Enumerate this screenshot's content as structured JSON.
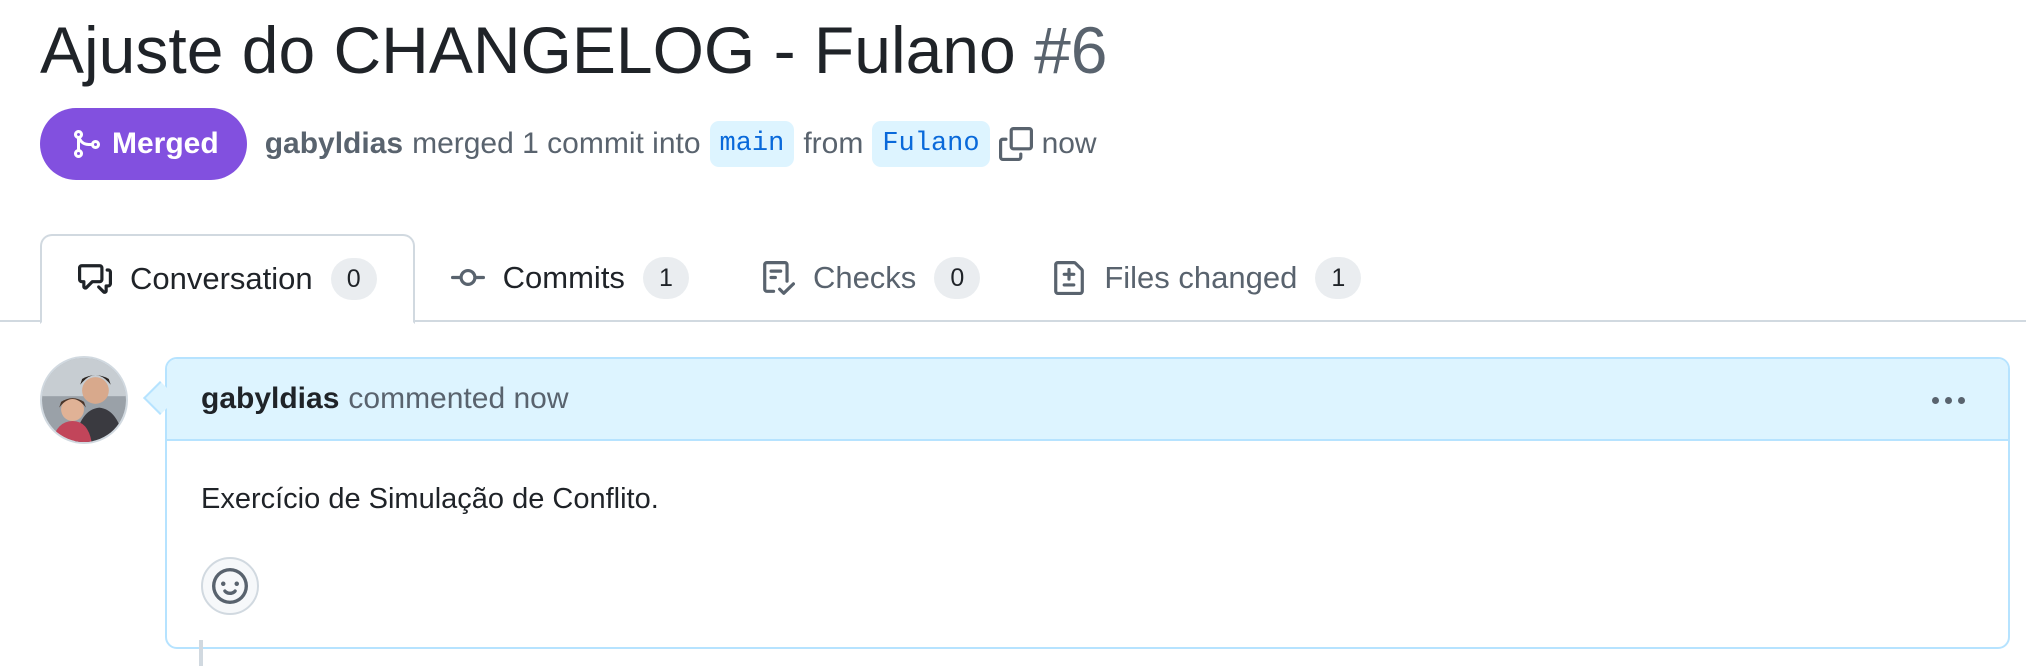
{
  "header": {
    "title": "Ajuste do CHANGELOG - Fulano",
    "number": "#6"
  },
  "meta": {
    "state_label": "Merged",
    "author": "gabyldias",
    "action": "merged 1 commit into",
    "base_branch": "main",
    "from_text": "from",
    "head_branch": "Fulano",
    "time": "now"
  },
  "tabs": [
    {
      "label": "Conversation",
      "count": "0",
      "icon": "comment-discussion-icon",
      "selected": true
    },
    {
      "label": "Commits",
      "count": "1",
      "icon": "git-commit-icon",
      "selected": false
    },
    {
      "label": "Checks",
      "count": "0",
      "icon": "checklist-icon",
      "selected": false
    },
    {
      "label": "Files changed",
      "count": "1",
      "icon": "file-diff-icon",
      "selected": false
    }
  ],
  "comment": {
    "author": "gabyldias",
    "action": "commented now",
    "body": "Exercício de Simulação de Conflito."
  },
  "colors": {
    "merged": "#8250df",
    "link": "#0969da",
    "comment_header_bg": "#ddf4ff"
  }
}
